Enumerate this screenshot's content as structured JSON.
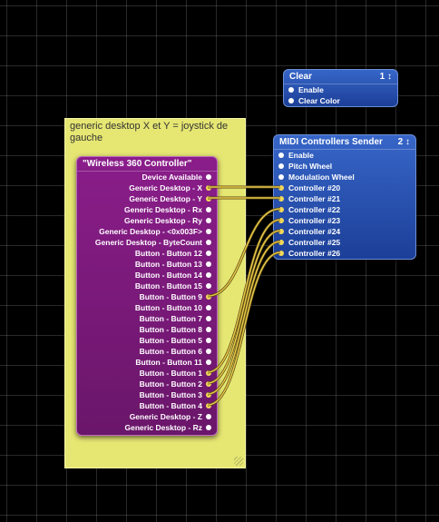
{
  "note": {
    "text": "generic desktop X et Y = joystick de gauche"
  },
  "clear_patch": {
    "title": "Clear",
    "index": "1 ↕",
    "inputs": [
      "Enable",
      "Clear Color"
    ]
  },
  "midi_patch": {
    "title": "MIDI Controllers Sender",
    "index": "2 ↕",
    "inputs": [
      "Enable",
      "Pitch Wheel",
      "Modulation Wheel",
      "Controller #20",
      "Controller #21",
      "Controller #22",
      "Controller #23",
      "Controller #24",
      "Controller #25",
      "Controller #26"
    ]
  },
  "controller_patch": {
    "title": "\"Wireless 360 Controller\"",
    "outputs": [
      "Device Available",
      "Generic Desktop - X",
      "Generic Desktop - Y",
      "Generic Desktop - Rx",
      "Generic Desktop - Ry",
      "Generic Desktop - <0x003F>",
      "Generic Desktop - ByteCount",
      "Button - Button 12",
      "Button - Button 13",
      "Button - Button 14",
      "Button - Button 15",
      "Button - Button 9",
      "Button - Button 10",
      "Button - Button 7",
      "Button - Button 8",
      "Button - Button 5",
      "Button - Button 6",
      "Button - Button 11",
      "Button - Button 1",
      "Button - Button 2",
      "Button - Button 3",
      "Button - Button 4",
      "Generic Desktop - Z",
      "Generic Desktop - Rz"
    ]
  },
  "connections": [
    {
      "from": "Generic Desktop - X",
      "to": "Controller #20"
    },
    {
      "from": "Generic Desktop - Y",
      "to": "Controller #21"
    },
    {
      "from": "Button - Button 9",
      "to": "Controller #22"
    },
    {
      "from": "Button - Button 1",
      "to": "Controller #23"
    },
    {
      "from": "Button - Button 2",
      "to": "Controller #24"
    },
    {
      "from": "Button - Button 3",
      "to": "Controller #25"
    },
    {
      "from": "Button - Button 4",
      "to": "Controller #26"
    }
  ],
  "colors": {
    "background": "#000000",
    "grid": "#2a2a2a",
    "note": "#e6e673",
    "blue_patch": "#2a53b8",
    "purple_patch": "#7d1a7d",
    "cable": "#e8c84a"
  }
}
